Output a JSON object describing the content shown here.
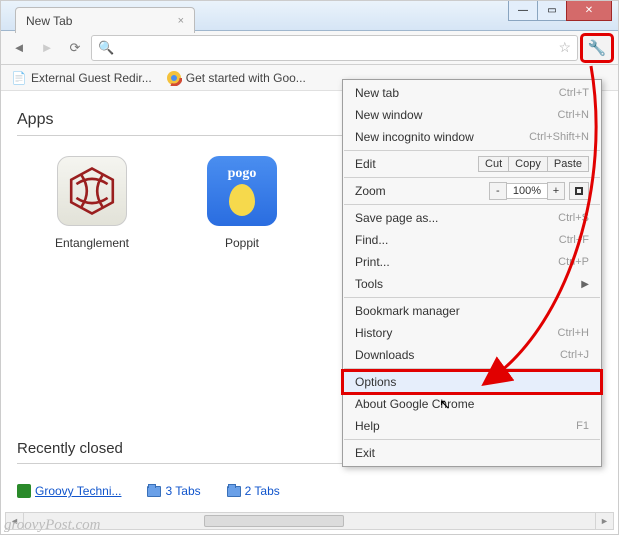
{
  "window": {
    "tab_title": "New Tab"
  },
  "bookmarks": {
    "item1": "External Guest Redir...",
    "item2": "Get started with Goo..."
  },
  "sections": {
    "apps_title": "Apps",
    "recently_title": "Recently closed"
  },
  "apps": {
    "entanglement": "Entanglement",
    "poppit": "Poppit",
    "poppit_logo": "pogo"
  },
  "recent": {
    "groovy": "Groovy Techni...",
    "tabs3": "3 Tabs",
    "tabs2": "2 Tabs"
  },
  "menu": {
    "new_tab": "New tab",
    "new_tab_k": "Ctrl+T",
    "new_window": "New window",
    "new_window_k": "Ctrl+N",
    "incognito": "New incognito window",
    "incognito_k": "Ctrl+Shift+N",
    "edit": "Edit",
    "cut": "Cut",
    "copy": "Copy",
    "paste": "Paste",
    "zoom": "Zoom",
    "zoom_minus": "-",
    "zoom_val": "100%",
    "zoom_plus": "+",
    "save_as": "Save page as...",
    "save_as_k": "Ctrl+S",
    "find": "Find...",
    "find_k": "Ctrl+F",
    "print": "Print...",
    "print_k": "Ctrl+P",
    "tools": "Tools",
    "bookmark_mgr": "Bookmark manager",
    "history": "History",
    "history_k": "Ctrl+H",
    "downloads": "Downloads",
    "downloads_k": "Ctrl+J",
    "options": "Options",
    "about": "About Google Chrome",
    "help": "Help",
    "help_k": "F1",
    "exit": "Exit"
  },
  "watermark": "groovyPost.com"
}
